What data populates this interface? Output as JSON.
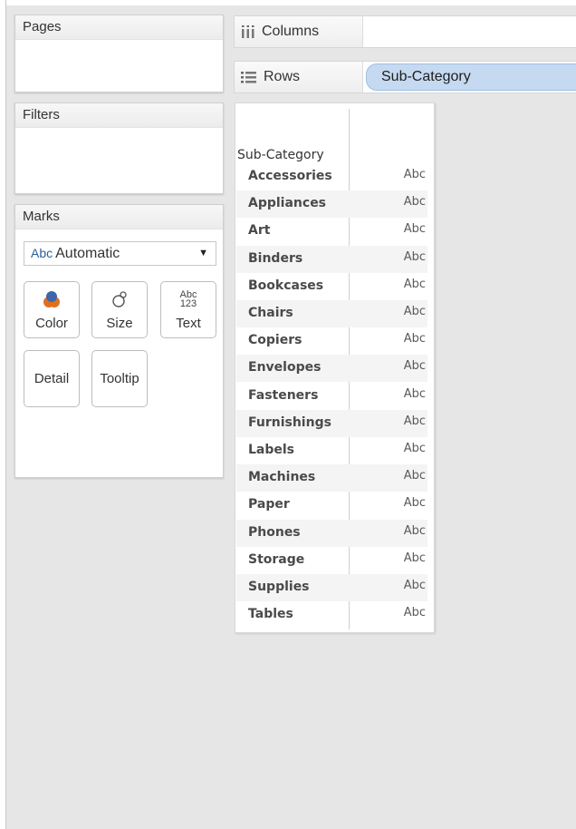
{
  "pages": {
    "title": "Pages"
  },
  "filters": {
    "title": "Filters"
  },
  "marks": {
    "title": "Marks",
    "mark_type": {
      "icon_text": "Abc",
      "value": "Automatic"
    },
    "buttons": [
      {
        "label": "Color",
        "icon": "color-icon"
      },
      {
        "label": "Size",
        "icon": "size-icon"
      },
      {
        "label": "Text",
        "icon": "text-icon"
      },
      {
        "label": "Detail"
      },
      {
        "label": "Tooltip"
      }
    ],
    "text_icon": {
      "line1": "Abc",
      "line2": "123"
    }
  },
  "shelves": {
    "columns": {
      "label": "Columns",
      "icon": "columns-icon"
    },
    "rows": {
      "label": "Rows",
      "icon": "rows-icon",
      "pill": "Sub-Category"
    }
  },
  "table": {
    "header": "Sub-Category",
    "rows": [
      {
        "category": "Accessories",
        "value": "Abc"
      },
      {
        "category": "Appliances",
        "value": "Abc"
      },
      {
        "category": "Art",
        "value": "Abc"
      },
      {
        "category": "Binders",
        "value": "Abc"
      },
      {
        "category": "Bookcases",
        "value": "Abc"
      },
      {
        "category": "Chairs",
        "value": "Abc"
      },
      {
        "category": "Copiers",
        "value": "Abc"
      },
      {
        "category": "Envelopes",
        "value": "Abc"
      },
      {
        "category": "Fasteners",
        "value": "Abc"
      },
      {
        "category": "Furnishings",
        "value": "Abc"
      },
      {
        "category": "Labels",
        "value": "Abc"
      },
      {
        "category": "Machines",
        "value": "Abc"
      },
      {
        "category": "Paper",
        "value": "Abc"
      },
      {
        "category": "Phones",
        "value": "Abc"
      },
      {
        "category": "Storage",
        "value": "Abc"
      },
      {
        "category": "Supplies",
        "value": "Abc"
      },
      {
        "category": "Tables",
        "value": "Abc"
      }
    ]
  },
  "colors": {
    "pill": "#c5daf1",
    "accent": "#2f5f98",
    "color_icon_orange": "#e0701e",
    "color_icon_blue": "#3f66a6"
  }
}
